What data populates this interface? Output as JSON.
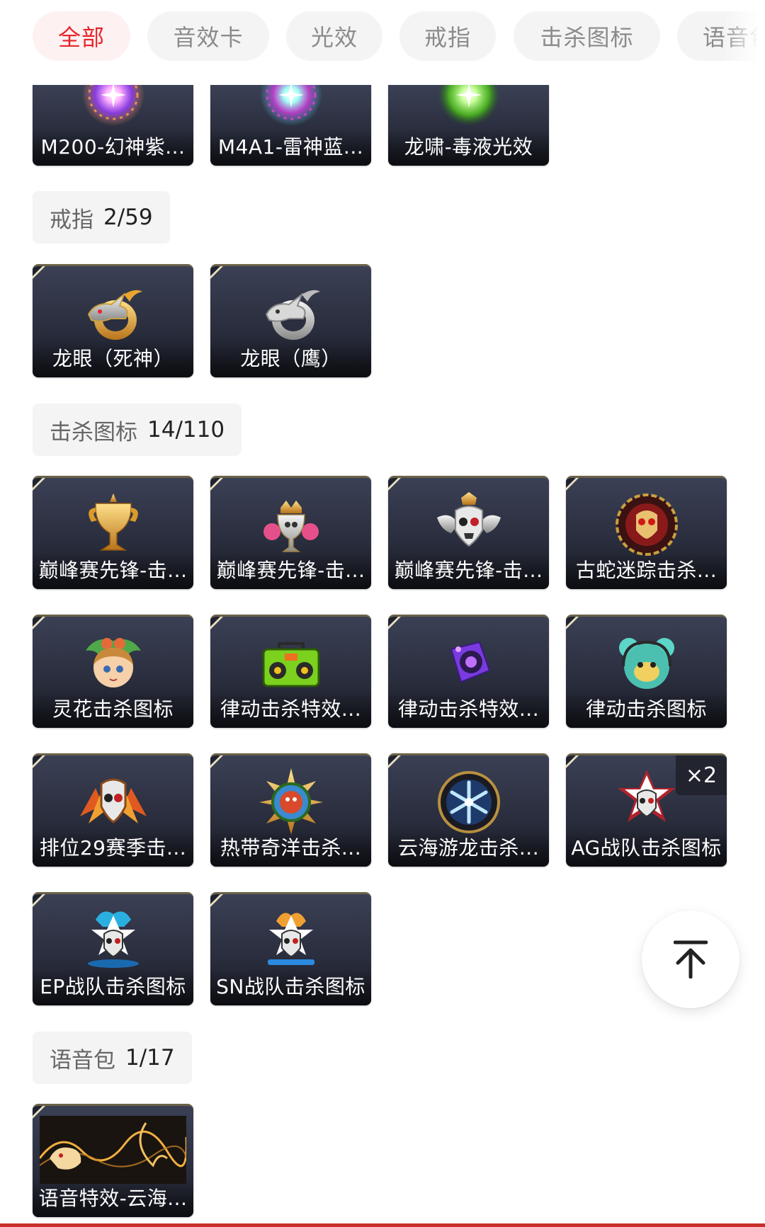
{
  "tabs": [
    {
      "label": "全部",
      "active": true
    },
    {
      "label": "音效卡",
      "active": false
    },
    {
      "label": "光效",
      "active": false
    },
    {
      "label": "戒指",
      "active": false
    },
    {
      "label": "击杀图标",
      "active": false
    },
    {
      "label": "语音包",
      "active": false
    }
  ],
  "light_effects": {
    "items": [
      {
        "label": "M200-幻神紫...",
        "icon": "purple-glow-icon"
      },
      {
        "label": "M4A1-雷神蓝...",
        "icon": "teal-glow-icon"
      },
      {
        "label": "龙啸-毒液光效",
        "icon": "green-glow-icon"
      }
    ]
  },
  "rings": {
    "name": "戒指",
    "count": "2/59",
    "items": [
      {
        "label": "龙眼（死神）",
        "icon": "gold-dragon-ring-icon"
      },
      {
        "label": "龙眼（鹰）",
        "icon": "silver-dragon-ring-icon"
      }
    ]
  },
  "kill_icons": {
    "name": "击杀图标",
    "count": "14/110",
    "items": [
      {
        "label": "巅峰赛先锋-击...",
        "icon": "gold-trophy-icon"
      },
      {
        "label": "巅峰赛先锋-击...",
        "icon": "crowned-trophy-icon"
      },
      {
        "label": "巅峰赛先锋-击...",
        "icon": "winged-skull-icon"
      },
      {
        "label": "古蛇迷踪击杀...",
        "icon": "red-skull-emblem-icon"
      },
      {
        "label": "灵花击杀图标",
        "icon": "flower-girl-icon"
      },
      {
        "label": "律动击杀特效...",
        "icon": "boombox-icon"
      },
      {
        "label": "律动击杀特效...",
        "icon": "purple-speaker-icon"
      },
      {
        "label": "律动击杀图标",
        "icon": "bear-headphones-icon"
      },
      {
        "label": "排位29赛季击...",
        "icon": "ranked-skull-icon"
      },
      {
        "label": "热带奇洋击杀...",
        "icon": "tropical-compass-icon"
      },
      {
        "label": "云海游龙击杀...",
        "icon": "snowflake-medallion-icon"
      },
      {
        "label": "AG战队击杀图标",
        "icon": "ag-skull-star-icon",
        "qty": "×2"
      },
      {
        "label": "EP战队击杀图标",
        "icon": "ep-skull-star-icon"
      },
      {
        "label": "SN战队击杀图标",
        "icon": "sn-skull-star-icon"
      }
    ]
  },
  "voice_packs": {
    "name": "语音包",
    "count": "1/17",
    "items": [
      {
        "label": "语音特效-云海...",
        "icon": "golden-dragon-wave-icon"
      }
    ]
  },
  "colors": {
    "accent": "#e5262b",
    "card_bg": "#2a2e3e"
  }
}
